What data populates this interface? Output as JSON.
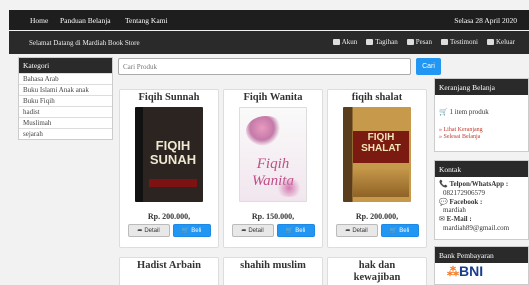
{
  "topnav": {
    "items": [
      "Home",
      "Panduan Belanja",
      "Tentang Kami"
    ],
    "date": "Selasa 28 April 2020"
  },
  "subbar": {
    "welcome": "Selamat Datang di Mardiah Book Store",
    "links": [
      {
        "label": "Akun",
        "icon": "user-icon"
      },
      {
        "label": "Tagihan",
        "icon": "invoice-icon"
      },
      {
        "label": "Pesan",
        "icon": "message-icon"
      },
      {
        "label": "Testimoni",
        "icon": "testimonial-icon"
      },
      {
        "label": "Keluar",
        "icon": "logout-icon"
      }
    ]
  },
  "kategori": {
    "title": "Kategori",
    "items": [
      "Bahasa Arab",
      "Buku Islami Anak anak",
      "Buku Fiqih",
      "hadist",
      "Muslimah",
      "sejarah"
    ]
  },
  "search": {
    "placeholder": "Cari Produk",
    "button": "Cari"
  },
  "products": [
    {
      "title": "Fiqih Sunnah",
      "price": "Rp. 200.000,",
      "detail": "Detail",
      "buy": "Beli",
      "cover_text": "FIQIH SUNAH"
    },
    {
      "title": "Fiqih Wanita",
      "price": "Rp. 150.000,",
      "detail": "Detail",
      "buy": "Beli",
      "cover_text": "Fiqih Wanita"
    },
    {
      "title": "fiqih shalat",
      "price": "Rp. 200.000,",
      "detail": "Detail",
      "buy": "Beli",
      "cover_text": "FIQIH SHALAT"
    },
    {
      "title": "Hadist Arbain"
    },
    {
      "title": "shahih muslim"
    },
    {
      "title": "hak dan kewajiban"
    }
  ],
  "cart": {
    "title": "Keranjang Belanja",
    "count": "1 item produk",
    "view_link": "» Lihat Keranjang",
    "checkout_link": "» Selesai Belanja"
  },
  "kontak": {
    "title": "Kontak",
    "phone_label": "Telpon/WhatsApp :",
    "phone": "082172906579",
    "fb_label": "Facebook :",
    "fb": "mardiah",
    "email_label": "E-Mail :",
    "email": "mardiah89@gmail.com"
  },
  "bank": {
    "title": "Bank Pembayaran",
    "name": "BNI"
  }
}
